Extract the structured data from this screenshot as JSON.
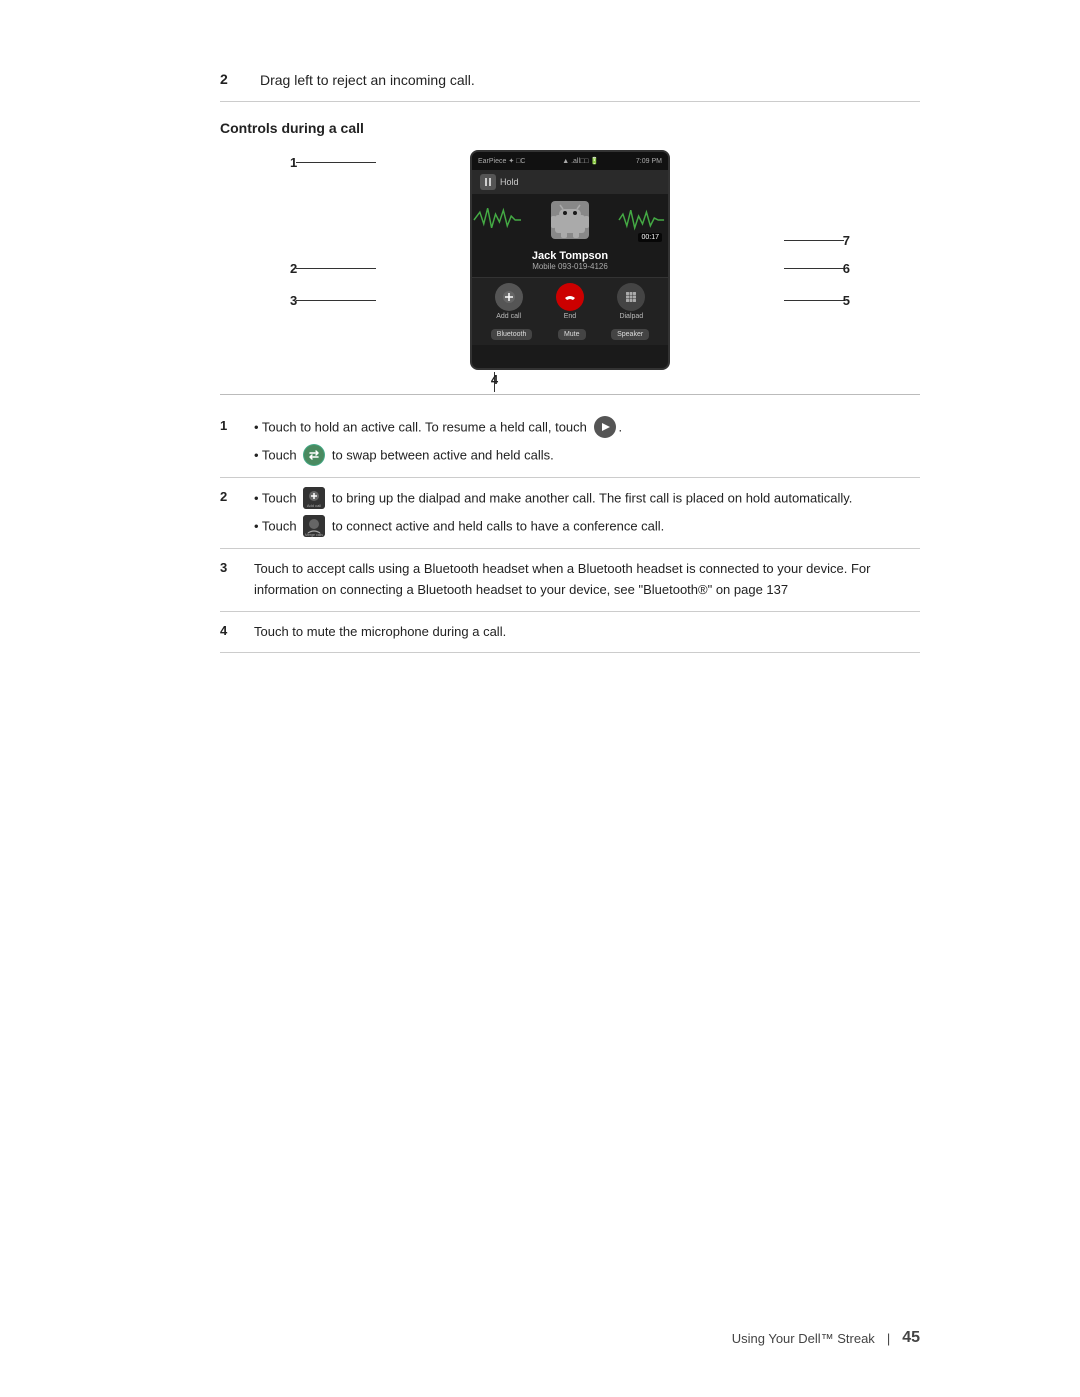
{
  "page": {
    "step2_num": "2",
    "step2_text": "Drag left to reject an incoming call.",
    "section_title": "Controls during a call",
    "phone": {
      "status_left": "EarPiece",
      "status_right": "7:09 PM",
      "hold_label": "Hold",
      "caller_name": "Jack Tompson",
      "caller_number": "Mobile 093-019-4126",
      "timer": "00:17",
      "buttons": [
        {
          "label": "Add call",
          "type": "add"
        },
        {
          "label": "End",
          "type": "end"
        },
        {
          "label": "Dialpad",
          "type": "dialpad"
        }
      ],
      "bottom_buttons": [
        {
          "label": "Bluetooth"
        },
        {
          "label": "Mute"
        },
        {
          "label": "Speaker"
        }
      ]
    },
    "annotations": [
      {
        "num": "1",
        "desc": "Hold button (top)"
      },
      {
        "num": "2",
        "desc": "Add call"
      },
      {
        "num": "3",
        "desc": "Bluetooth"
      },
      {
        "num": "4",
        "desc": "Mute (bottom center)"
      },
      {
        "num": "5",
        "desc": "Speaker"
      },
      {
        "num": "6",
        "desc": "Dialpad"
      },
      {
        "num": "7",
        "desc": "Caller info area"
      }
    ],
    "descriptions": [
      {
        "num": "1",
        "bullets": [
          "Touch to hold an active call. To resume a held call, touch  .",
          "Touch  to swap between active and held calls."
        ]
      },
      {
        "num": "2",
        "bullets": [
          "Touch  to bring up the dialpad and make another call. The first call is placed on hold automatically.",
          "Touch  to connect active and held calls to have a conference call."
        ]
      },
      {
        "num": "3",
        "text": "Touch to accept calls using a Bluetooth headset when a Bluetooth headset is connected to your device. For information on connecting a Bluetooth headset to your device, see \"Bluetooth®\" on page 137"
      },
      {
        "num": "4",
        "text": "Touch to mute the microphone during a call."
      }
    ],
    "footer": {
      "text": "Using Your Dell™ Streak",
      "separator": "|",
      "page_num": "45"
    }
  }
}
